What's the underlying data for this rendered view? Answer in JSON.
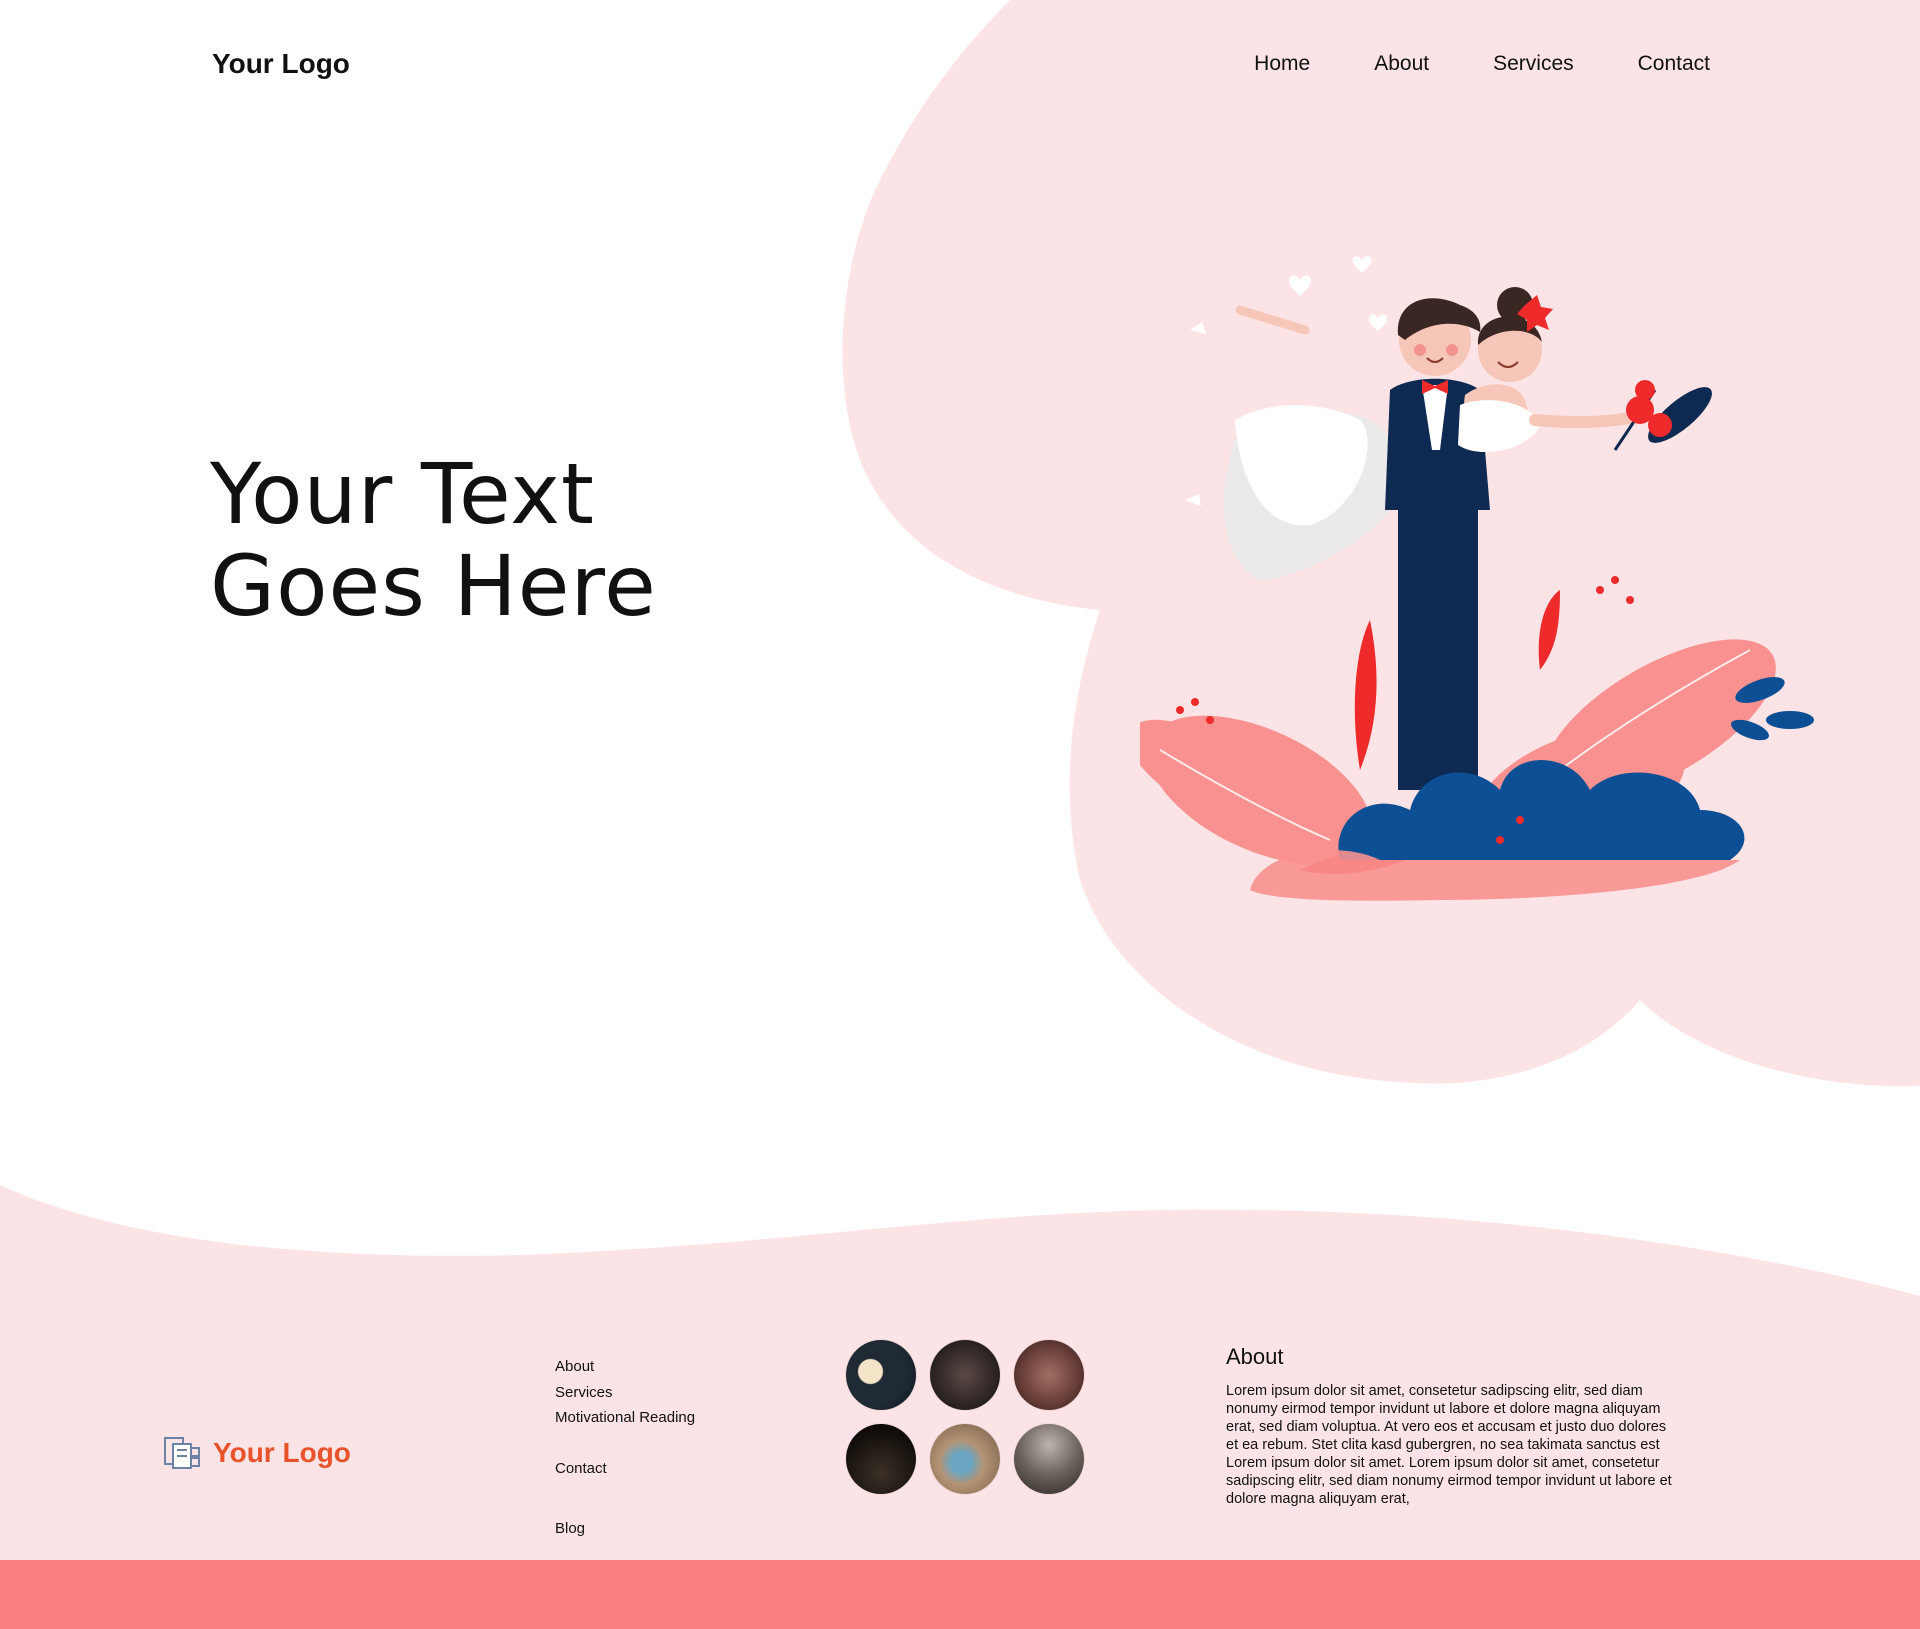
{
  "header": {
    "logo": "Your Logo",
    "nav": [
      "Home",
      "About",
      "Services",
      "Contact"
    ]
  },
  "hero": {
    "title_line1": "Your Text",
    "title_line2": "Goes Here"
  },
  "footer": {
    "logo": "Your Logo",
    "links": [
      "About",
      "Services",
      "Motivational Reading",
      "Contact",
      "Blog"
    ],
    "about_title": "About",
    "about_text": "Lorem ipsum dolor sit amet, consetetur sadipscing elitr, sed diam nonumy eirmod tempor invidunt ut labore et dolore magna aliquyam erat, sed diam voluptua. At vero eos et accusam et justo duo dolores et ea rebum. Stet clita kasd gubergren, no sea takimata sanctus est Lorem ipsum dolor sit amet. Lorem ipsum dolor sit amet, consetetur sadipscing elitr, sed diam nonumy eirmod tempor invidunt ut labore et dolore magna aliquyam erat,"
  },
  "colors": {
    "pink_bg": "#fce4e6",
    "bottom_bar": "#f98281",
    "footer_logo": "#e8532b",
    "navy": "#0e2a52",
    "blue": "#0c4f95",
    "red": "#ee2a2a",
    "salmon": "#f89190"
  },
  "icons": [
    "logo-mark-icon"
  ]
}
